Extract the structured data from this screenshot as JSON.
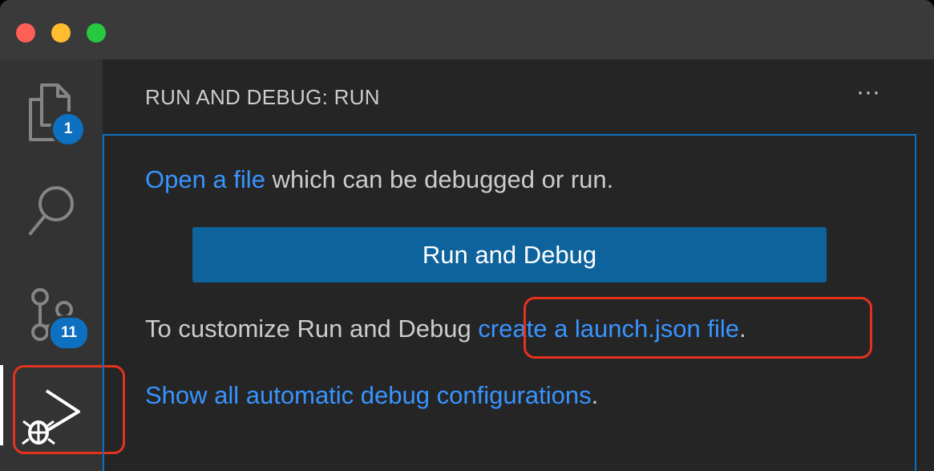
{
  "window": {
    "controls": {
      "close_color": "#fe5f57",
      "minimize_color": "#febc2e",
      "maximize_color": "#28c840"
    }
  },
  "activity_bar": {
    "items": [
      {
        "name": "explorer",
        "icon": "files-icon",
        "badge": "1"
      },
      {
        "name": "search",
        "icon": "search-icon"
      },
      {
        "name": "source-control",
        "icon": "source-control-icon",
        "badge": "11"
      },
      {
        "name": "run-and-debug",
        "icon": "run-debug-icon",
        "active": true
      }
    ]
  },
  "sidebar": {
    "title": "RUN AND DEBUG: RUN",
    "more_actions_label": "···"
  },
  "debug_view": {
    "open_file_link": "Open a file",
    "open_file_suffix": " which can be debugged or run.",
    "run_button_label": "Run and Debug",
    "customize_prefix": "To customize Run and Debug ",
    "launch_json_link": "create a launch.json file",
    "customize_suffix": ".",
    "show_configs_link": "Show all automatic debug configurations",
    "show_configs_suffix": "."
  },
  "colors": {
    "link": "#3794ff",
    "button": "#0e639c",
    "badge": "#0e70c0",
    "focus_border": "#0e70c0",
    "annotation": "#e5321e"
  }
}
